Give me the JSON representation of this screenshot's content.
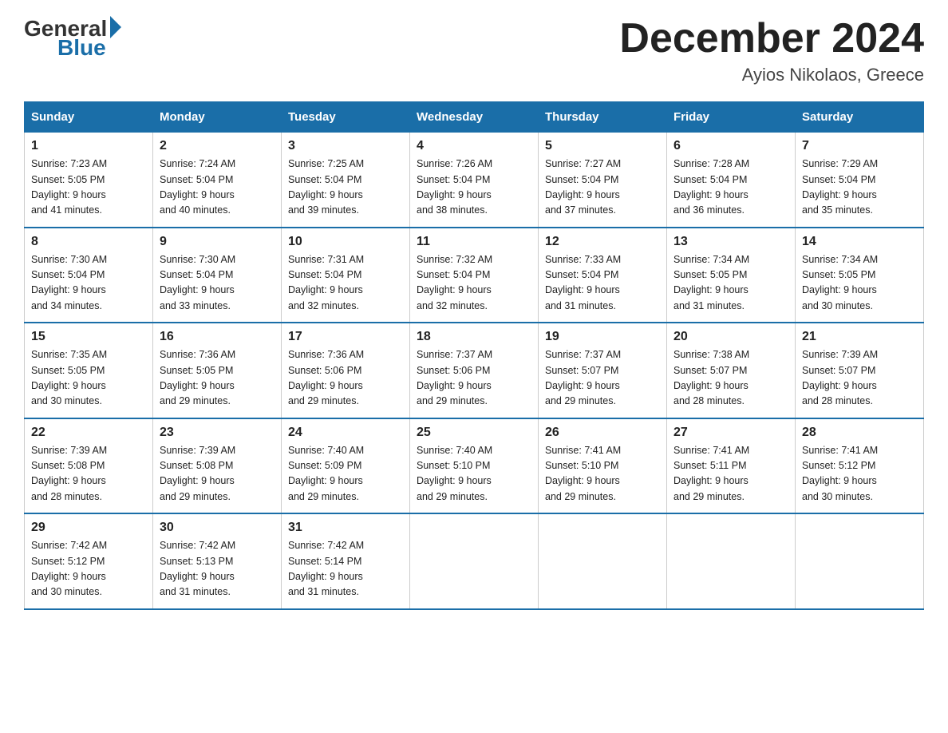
{
  "header": {
    "logo_general": "General",
    "logo_blue": "Blue",
    "month_title": "December 2024",
    "location": "Ayios Nikolaos, Greece"
  },
  "days_of_week": [
    "Sunday",
    "Monday",
    "Tuesday",
    "Wednesday",
    "Thursday",
    "Friday",
    "Saturday"
  ],
  "weeks": [
    [
      {
        "day": "1",
        "sunrise": "7:23 AM",
        "sunset": "5:05 PM",
        "daylight": "9 hours and 41 minutes."
      },
      {
        "day": "2",
        "sunrise": "7:24 AM",
        "sunset": "5:04 PM",
        "daylight": "9 hours and 40 minutes."
      },
      {
        "day": "3",
        "sunrise": "7:25 AM",
        "sunset": "5:04 PM",
        "daylight": "9 hours and 39 minutes."
      },
      {
        "day": "4",
        "sunrise": "7:26 AM",
        "sunset": "5:04 PM",
        "daylight": "9 hours and 38 minutes."
      },
      {
        "day": "5",
        "sunrise": "7:27 AM",
        "sunset": "5:04 PM",
        "daylight": "9 hours and 37 minutes."
      },
      {
        "day": "6",
        "sunrise": "7:28 AM",
        "sunset": "5:04 PM",
        "daylight": "9 hours and 36 minutes."
      },
      {
        "day": "7",
        "sunrise": "7:29 AM",
        "sunset": "5:04 PM",
        "daylight": "9 hours and 35 minutes."
      }
    ],
    [
      {
        "day": "8",
        "sunrise": "7:30 AM",
        "sunset": "5:04 PM",
        "daylight": "9 hours and 34 minutes."
      },
      {
        "day": "9",
        "sunrise": "7:30 AM",
        "sunset": "5:04 PM",
        "daylight": "9 hours and 33 minutes."
      },
      {
        "day": "10",
        "sunrise": "7:31 AM",
        "sunset": "5:04 PM",
        "daylight": "9 hours and 32 minutes."
      },
      {
        "day": "11",
        "sunrise": "7:32 AM",
        "sunset": "5:04 PM",
        "daylight": "9 hours and 32 minutes."
      },
      {
        "day": "12",
        "sunrise": "7:33 AM",
        "sunset": "5:04 PM",
        "daylight": "9 hours and 31 minutes."
      },
      {
        "day": "13",
        "sunrise": "7:34 AM",
        "sunset": "5:05 PM",
        "daylight": "9 hours and 31 minutes."
      },
      {
        "day": "14",
        "sunrise": "7:34 AM",
        "sunset": "5:05 PM",
        "daylight": "9 hours and 30 minutes."
      }
    ],
    [
      {
        "day": "15",
        "sunrise": "7:35 AM",
        "sunset": "5:05 PM",
        "daylight": "9 hours and 30 minutes."
      },
      {
        "day": "16",
        "sunrise": "7:36 AM",
        "sunset": "5:05 PM",
        "daylight": "9 hours and 29 minutes."
      },
      {
        "day": "17",
        "sunrise": "7:36 AM",
        "sunset": "5:06 PM",
        "daylight": "9 hours and 29 minutes."
      },
      {
        "day": "18",
        "sunrise": "7:37 AM",
        "sunset": "5:06 PM",
        "daylight": "9 hours and 29 minutes."
      },
      {
        "day": "19",
        "sunrise": "7:37 AM",
        "sunset": "5:07 PM",
        "daylight": "9 hours and 29 minutes."
      },
      {
        "day": "20",
        "sunrise": "7:38 AM",
        "sunset": "5:07 PM",
        "daylight": "9 hours and 28 minutes."
      },
      {
        "day": "21",
        "sunrise": "7:39 AM",
        "sunset": "5:07 PM",
        "daylight": "9 hours and 28 minutes."
      }
    ],
    [
      {
        "day": "22",
        "sunrise": "7:39 AM",
        "sunset": "5:08 PM",
        "daylight": "9 hours and 28 minutes."
      },
      {
        "day": "23",
        "sunrise": "7:39 AM",
        "sunset": "5:08 PM",
        "daylight": "9 hours and 29 minutes."
      },
      {
        "day": "24",
        "sunrise": "7:40 AM",
        "sunset": "5:09 PM",
        "daylight": "9 hours and 29 minutes."
      },
      {
        "day": "25",
        "sunrise": "7:40 AM",
        "sunset": "5:10 PM",
        "daylight": "9 hours and 29 minutes."
      },
      {
        "day": "26",
        "sunrise": "7:41 AM",
        "sunset": "5:10 PM",
        "daylight": "9 hours and 29 minutes."
      },
      {
        "day": "27",
        "sunrise": "7:41 AM",
        "sunset": "5:11 PM",
        "daylight": "9 hours and 29 minutes."
      },
      {
        "day": "28",
        "sunrise": "7:41 AM",
        "sunset": "5:12 PM",
        "daylight": "9 hours and 30 minutes."
      }
    ],
    [
      {
        "day": "29",
        "sunrise": "7:42 AM",
        "sunset": "5:12 PM",
        "daylight": "9 hours and 30 minutes."
      },
      {
        "day": "30",
        "sunrise": "7:42 AM",
        "sunset": "5:13 PM",
        "daylight": "9 hours and 31 minutes."
      },
      {
        "day": "31",
        "sunrise": "7:42 AM",
        "sunset": "5:14 PM",
        "daylight": "9 hours and 31 minutes."
      },
      null,
      null,
      null,
      null
    ]
  ]
}
